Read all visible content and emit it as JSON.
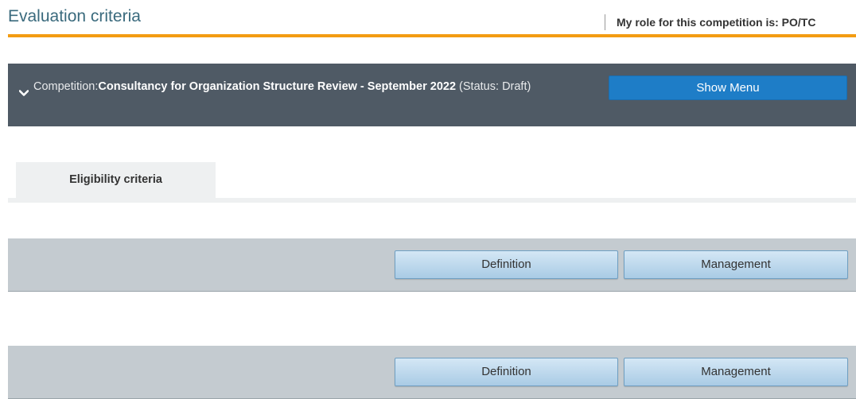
{
  "header": {
    "title": "Evaluation criteria",
    "role_text": "My role for this competition is: PO/TC"
  },
  "competition": {
    "prefix": "Competition:",
    "name": "Consultancy for Organization Structure Review - September 2022",
    "status_open": " (Status: ",
    "status": "Draft",
    "status_close": ")",
    "show_menu_label": "Show Menu"
  },
  "tabs": [
    {
      "label": "Eligibility criteria"
    }
  ],
  "panels": [
    {
      "definition_label": "Definition",
      "management_label": "Management"
    },
    {
      "definition_label": "Definition",
      "management_label": "Management"
    }
  ],
  "colors": {
    "title": "#3a6a7d",
    "accent_rule": "#f39c12",
    "competition_bar": "#4f5a65",
    "show_menu_button": "#1e7dc7",
    "panel": "#c4cbd0",
    "panel_button": "#a9cbe5"
  },
  "icons": {
    "competition_toggle": "chevron-down-icon"
  }
}
